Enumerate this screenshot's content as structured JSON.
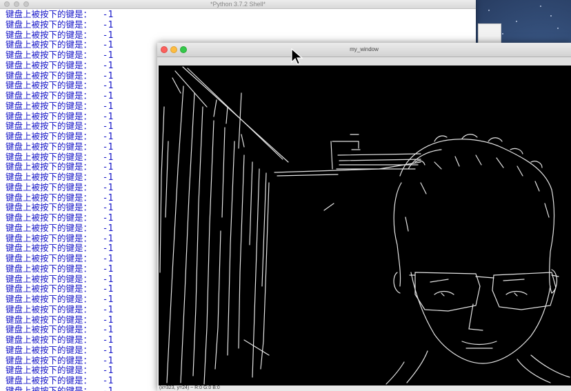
{
  "shell": {
    "title": "*Python 3.7.2 Shell*",
    "line_label": "键盘上被按下的键是：",
    "line_value": "-1",
    "line_count": 38
  },
  "cv_window": {
    "title": "my_window",
    "status": "(x=323, y=24) ~ R:0 G:0 B:0"
  },
  "colors": {
    "output_text": "#1515c8",
    "close": "#fc605c",
    "minimize": "#fdbc40",
    "zoom": "#34c84a"
  },
  "icons": [
    "close-icon",
    "minimize-icon",
    "zoom-icon",
    "pointer-cursor-icon"
  ]
}
